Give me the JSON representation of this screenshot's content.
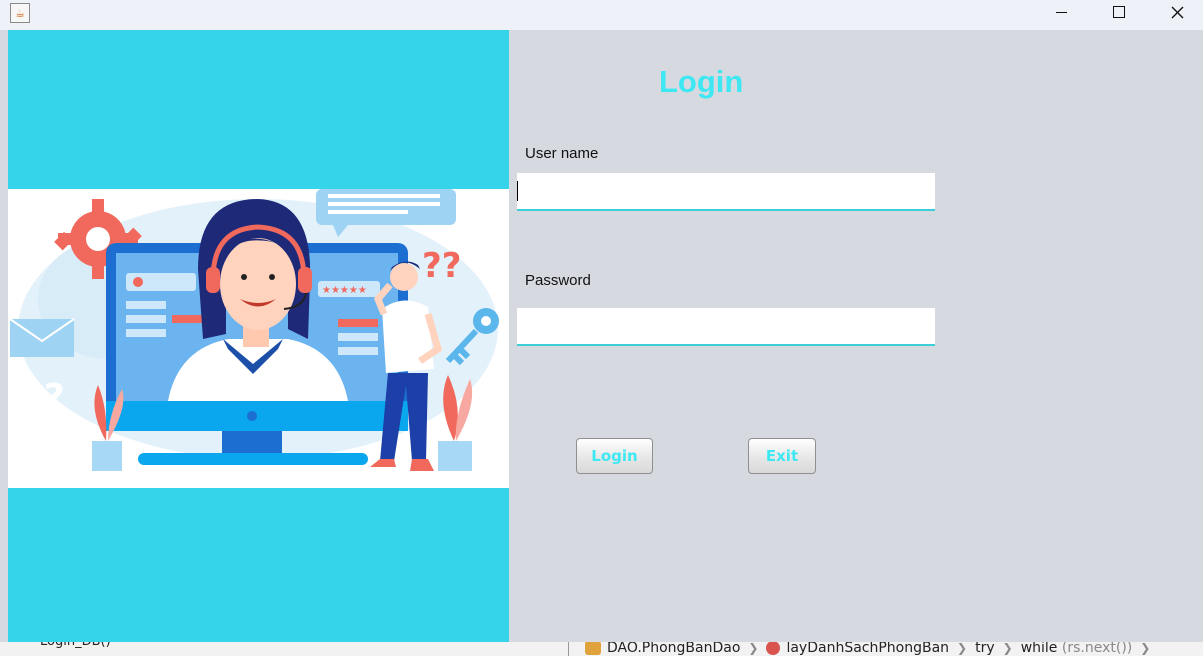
{
  "window": {
    "app_icon": "java-cup-icon",
    "controls": [
      "minimize-icon",
      "maximize-icon",
      "close-icon"
    ]
  },
  "illustration": {
    "alt": "customer-support-illustration",
    "colors": {
      "panel": "#36d4ea",
      "monitor": "#1c6fd1",
      "accent": "#f2776a"
    }
  },
  "form": {
    "title": "Login",
    "username_label": "User name",
    "username_value": "",
    "password_label": "Password",
    "password_value": "",
    "login_button": "Login",
    "exit_button": "Exit",
    "accent_color": "#3ee8f2"
  },
  "background_ide": {
    "left_fragment": "Login_DB()",
    "breadcrumbs": [
      {
        "label": "DAO.PhongBanDao",
        "icon": "class-icon"
      },
      {
        "label": "layDanhSachPhongBan",
        "icon": "method-icon"
      },
      {
        "label": "try",
        "icon": ""
      },
      {
        "label": "while",
        "extra": "(rs.next())",
        "icon": ""
      }
    ]
  }
}
